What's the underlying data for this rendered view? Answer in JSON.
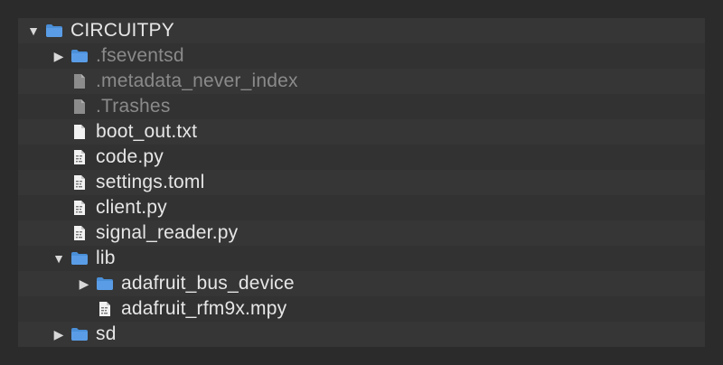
{
  "tree": {
    "rows": [
      {
        "label": "CIRCUITPY",
        "depth": 0,
        "arrow": "expanded",
        "icon": "folder-icon",
        "hidden": false
      },
      {
        "label": ".fseventsd",
        "depth": 1,
        "arrow": "collapsed",
        "icon": "folder-icon",
        "hidden": true
      },
      {
        "label": ".metadata_never_index",
        "depth": 1,
        "arrow": "none",
        "icon": "file-icon",
        "hidden": true
      },
      {
        "label": ".Trashes",
        "depth": 1,
        "arrow": "none",
        "icon": "file-icon",
        "hidden": true
      },
      {
        "label": "boot_out.txt",
        "depth": 1,
        "arrow": "none",
        "icon": "text-file-icon",
        "hidden": false
      },
      {
        "label": "code.py",
        "depth": 1,
        "arrow": "none",
        "icon": "code-file-icon",
        "hidden": false
      },
      {
        "label": "settings.toml",
        "depth": 1,
        "arrow": "none",
        "icon": "code-file-icon",
        "hidden": false
      },
      {
        "label": "client.py",
        "depth": 1,
        "arrow": "none",
        "icon": "code-file-icon",
        "hidden": false
      },
      {
        "label": "signal_reader.py",
        "depth": 1,
        "arrow": "none",
        "icon": "code-file-icon",
        "hidden": false
      },
      {
        "label": "lib",
        "depth": 1,
        "arrow": "expanded",
        "icon": "folder-icon",
        "hidden": false
      },
      {
        "label": "adafruit_bus_device",
        "depth": 2,
        "arrow": "collapsed",
        "icon": "folder-icon",
        "hidden": false
      },
      {
        "label": "adafruit_rfm9x.mpy",
        "depth": 2,
        "arrow": "none",
        "icon": "code-file-icon",
        "hidden": false
      },
      {
        "label": "sd",
        "depth": 1,
        "arrow": "collapsed",
        "icon": "folder-icon",
        "hidden": false
      }
    ]
  },
  "colors": {
    "background": "#2b2b2b",
    "panel": "#333333",
    "text": "#e6e6e6",
    "hidden_text": "#8a8a8a",
    "folder": "#4a8fd8"
  }
}
